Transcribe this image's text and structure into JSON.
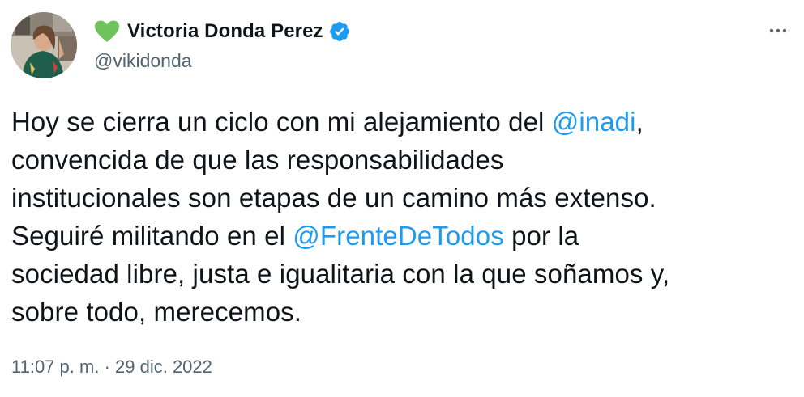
{
  "author": {
    "display_name": "Victoria Donda Perez",
    "handle": "@vikidonda",
    "name_emoji_icon": "green-heart-icon",
    "verified_icon": "verified-badge-icon"
  },
  "menu": {
    "icon": "more-options-icon"
  },
  "tweet": {
    "lines": [
      {
        "before": "Hoy se cierra un ciclo con mi alejamiento del ",
        "mention": "@inadi",
        "after": ","
      },
      {
        "text": "convencida de que las responsabilidades"
      },
      {
        "text": "institucionales son etapas de un camino más extenso."
      },
      {
        "before": "Seguiré militando en el ",
        "mention": "@FrenteDeTodos",
        "after": " por la"
      },
      {
        "text": "sociedad libre, justa e igualitaria con la que soñamos y,"
      },
      {
        "text": "sobre todo, merecemos."
      }
    ]
  },
  "meta": {
    "time": "11:07 p. m.",
    "separator": "·",
    "date": "29 dic. 2022"
  },
  "colors": {
    "link": "#1d9bf0",
    "secondary_text": "#536471",
    "heart": "#6ec35b",
    "verified": "#1d9bf0"
  }
}
